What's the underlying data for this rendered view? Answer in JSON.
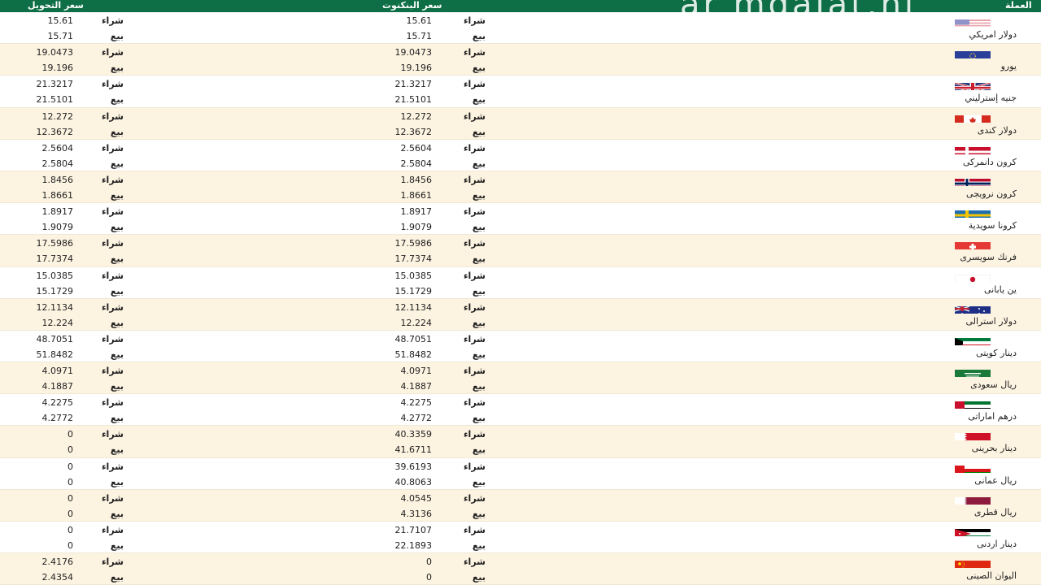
{
  "header": {
    "conversion_label": "سعر التحويل",
    "bank_label": "سعر البنكنوت",
    "currency_label": "العملة",
    "watermark": "ar mqalat.nl"
  },
  "labels": {
    "buy": "شراء",
    "sell": "بيع"
  },
  "rows": [
    {
      "name": "دولار امريكي",
      "flag": "us-flag-icon",
      "bank_buy": "15.61",
      "bank_sell": "15.71",
      "conv_buy": "15.61",
      "conv_sell": "15.71"
    },
    {
      "name": "يورو",
      "flag": "eu-flag-icon",
      "bank_buy": "19.0473",
      "bank_sell": "19.196",
      "conv_buy": "19.0473",
      "conv_sell": "19.196"
    },
    {
      "name": "جنيه إسترليني",
      "flag": "uk-flag-icon",
      "bank_buy": "21.3217",
      "bank_sell": "21.5101",
      "conv_buy": "21.3217",
      "conv_sell": "21.5101"
    },
    {
      "name": "دولار كندى",
      "flag": "canada-flag-icon",
      "bank_buy": "12.272",
      "bank_sell": "12.3672",
      "conv_buy": "12.272",
      "conv_sell": "12.3672"
    },
    {
      "name": "كرون دانمركى",
      "flag": "denmark-flag-icon",
      "bank_buy": "2.5604",
      "bank_sell": "2.5804",
      "conv_buy": "2.5604",
      "conv_sell": "2.5804"
    },
    {
      "name": "كرون نرويجى",
      "flag": "norway-flag-icon",
      "bank_buy": "1.8456",
      "bank_sell": "1.8661",
      "conv_buy": "1.8456",
      "conv_sell": "1.8661"
    },
    {
      "name": "كرونا سويدية",
      "flag": "sweden-flag-icon",
      "bank_buy": "1.8917",
      "bank_sell": "1.9079",
      "conv_buy": "1.8917",
      "conv_sell": "1.9079"
    },
    {
      "name": "فرنك سويسرى",
      "flag": "switzerland-flag-icon",
      "bank_buy": "17.5986",
      "bank_sell": "17.7374",
      "conv_buy": "17.5986",
      "conv_sell": "17.7374"
    },
    {
      "name": "ين يابانى",
      "flag": "japan-flag-icon",
      "bank_buy": "15.0385",
      "bank_sell": "15.1729",
      "conv_buy": "15.0385",
      "conv_sell": "15.1729"
    },
    {
      "name": "دولار استرالى",
      "flag": "australia-flag-icon",
      "bank_buy": "12.1134",
      "bank_sell": "12.224",
      "conv_buy": "12.1134",
      "conv_sell": "12.224"
    },
    {
      "name": "دينار كويتى",
      "flag": "kuwait-flag-icon",
      "bank_buy": "48.7051",
      "bank_sell": "51.8482",
      "conv_buy": "48.7051",
      "conv_sell": "51.8482"
    },
    {
      "name": "ريال سعودى",
      "flag": "saudi-flag-icon",
      "bank_buy": "4.0971",
      "bank_sell": "4.1887",
      "conv_buy": "4.0971",
      "conv_sell": "4.1887"
    },
    {
      "name": "درهم اماراتى",
      "flag": "uae-flag-icon",
      "bank_buy": "4.2275",
      "bank_sell": "4.2772",
      "conv_buy": "4.2275",
      "conv_sell": "4.2772"
    },
    {
      "name": "دينار بحرينى",
      "flag": "bahrain-flag-icon",
      "bank_buy": "40.3359",
      "bank_sell": "41.6711",
      "conv_buy": "0",
      "conv_sell": "0"
    },
    {
      "name": "ريال عمانى",
      "flag": "oman-flag-icon",
      "bank_buy": "39.6193",
      "bank_sell": "40.8063",
      "conv_buy": "0",
      "conv_sell": "0"
    },
    {
      "name": "ريال قطرى",
      "flag": "qatar-flag-icon",
      "bank_buy": "4.0545",
      "bank_sell": "4.3136",
      "conv_buy": "0",
      "conv_sell": "0"
    },
    {
      "name": "دينار اردنى",
      "flag": "jordan-flag-icon",
      "bank_buy": "21.7107",
      "bank_sell": "22.1893",
      "conv_buy": "0",
      "conv_sell": "0"
    },
    {
      "name": "اليوان الصينى",
      "flag": "china-flag-icon",
      "bank_buy": "0",
      "bank_sell": "0",
      "conv_buy": "2.4176",
      "conv_sell": "2.4354"
    }
  ]
}
